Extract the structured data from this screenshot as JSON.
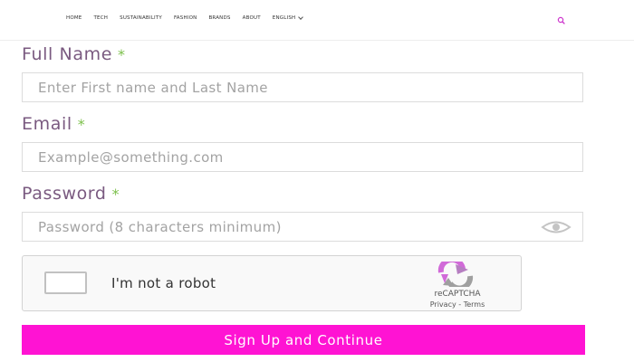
{
  "nav": {
    "items": [
      {
        "label": "HOME"
      },
      {
        "label": "TECH"
      },
      {
        "label": "SUSTAINABILITY"
      },
      {
        "label": "FASHION"
      },
      {
        "label": "BRANDS"
      },
      {
        "label": "ABOUT"
      },
      {
        "label": "ENGLISH",
        "has_dropdown": true
      }
    ],
    "search_icon": "search-icon",
    "search_color": "#cc33cc"
  },
  "form": {
    "full_name": {
      "label": "Full Name",
      "required_mark": "*",
      "placeholder": "Enter First name and Last Name",
      "value": ""
    },
    "email": {
      "label": "Email",
      "required_mark": "*",
      "placeholder": "Example@something.com",
      "value": ""
    },
    "password": {
      "label": "Password",
      "required_mark": "*",
      "placeholder": "Password (8 characters minimum)",
      "value": "",
      "toggle_icon": "eye-icon"
    },
    "captcha": {
      "label": "I'm not a robot",
      "checked": false,
      "brand": "reCAPTCHA",
      "privacy": "Privacy",
      "separator": "-",
      "terms": "Terms"
    },
    "submit_label": "Sign Up and Continue"
  },
  "colors": {
    "accent": "#ff13d3",
    "label": "#7a5a80",
    "required": "#7cc04b"
  }
}
